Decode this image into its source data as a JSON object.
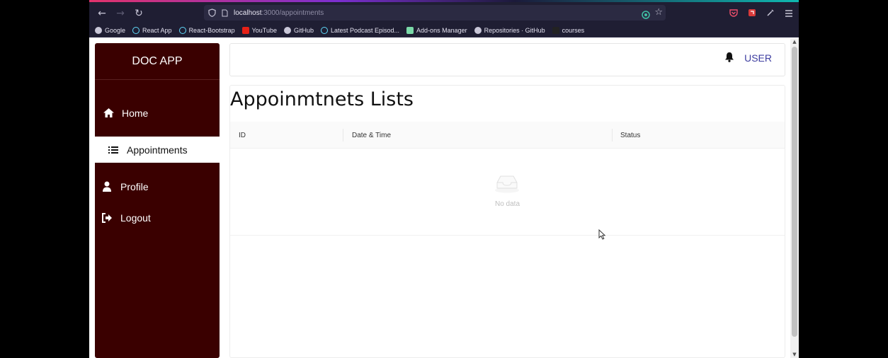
{
  "browser": {
    "url_host": "localhost",
    "url_path": ":3000/appointments",
    "bookmarks": [
      {
        "label": "Google",
        "icon": "google-icon"
      },
      {
        "label": "React App",
        "icon": "react-icon"
      },
      {
        "label": "React-Bootstrap",
        "icon": "react-bootstrap-icon"
      },
      {
        "label": "YouTube",
        "icon": "youtube-icon"
      },
      {
        "label": "GitHub",
        "icon": "github-icon"
      },
      {
        "label": "Latest Podcast Episod...",
        "icon": "podcast-icon"
      },
      {
        "label": "Add-ons Manager",
        "icon": "addons-icon"
      },
      {
        "label": "Repositories · GitHub",
        "icon": "github-icon"
      },
      {
        "label": "courses",
        "icon": "folder-icon"
      }
    ]
  },
  "sidebar": {
    "logo": "DOC APP",
    "items": [
      {
        "label": "Home",
        "icon": "home-icon",
        "active": false
      },
      {
        "label": "Appointments",
        "icon": "list-icon",
        "active": true
      },
      {
        "label": "Profile",
        "icon": "user-icon",
        "active": false
      },
      {
        "label": "Logout",
        "icon": "logout-icon",
        "active": false
      }
    ]
  },
  "header": {
    "user_label": "USER",
    "bell_icon": "bell-icon"
  },
  "main": {
    "title": "Appoinmtnets Lists",
    "columns": [
      "ID",
      "Date & Time",
      "Status"
    ],
    "empty_text": "No data"
  },
  "colors": {
    "sidebar_bg": "#3a0000",
    "user_link": "#3e3ea0",
    "browser_chrome": "#1f1e33"
  }
}
